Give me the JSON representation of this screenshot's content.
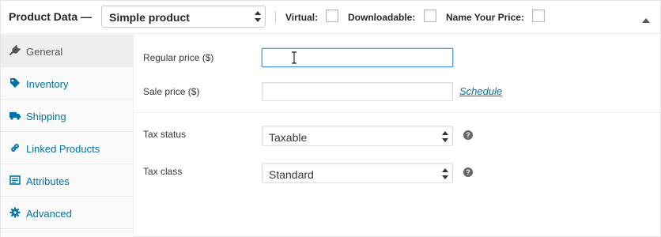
{
  "header": {
    "title": "Product Data —",
    "product_type": "Simple product",
    "checkboxes": [
      {
        "label": "Virtual:",
        "checked": false
      },
      {
        "label": "Downloadable:",
        "checked": false
      },
      {
        "label": "Name Your Price:",
        "checked": false
      }
    ],
    "collapse_icon": "triangle-up-icon"
  },
  "sidebar": {
    "items": [
      {
        "label": "General",
        "icon": "wrench-icon",
        "active": true
      },
      {
        "label": "Inventory",
        "icon": "tag-icon",
        "active": false
      },
      {
        "label": "Shipping",
        "icon": "truck-icon",
        "active": false
      },
      {
        "label": "Linked Products",
        "icon": "link-icon",
        "active": false
      },
      {
        "label": "Attributes",
        "icon": "list-icon",
        "active": false
      },
      {
        "label": "Advanced",
        "icon": "gear-icon",
        "active": false
      }
    ]
  },
  "general": {
    "regular_price": {
      "label": "Regular price ($)",
      "value": ""
    },
    "sale_price": {
      "label": "Sale price ($)",
      "value": "",
      "schedule_link": "Schedule"
    },
    "tax_status": {
      "label": "Tax status",
      "value": "Taxable"
    },
    "tax_class": {
      "label": "Tax class",
      "value": "Standard"
    },
    "help_glyph": "?"
  },
  "colors": {
    "link": "#0073aa",
    "focus_border": "#5b9dd9",
    "active_tab_bg": "#eeeeee"
  }
}
